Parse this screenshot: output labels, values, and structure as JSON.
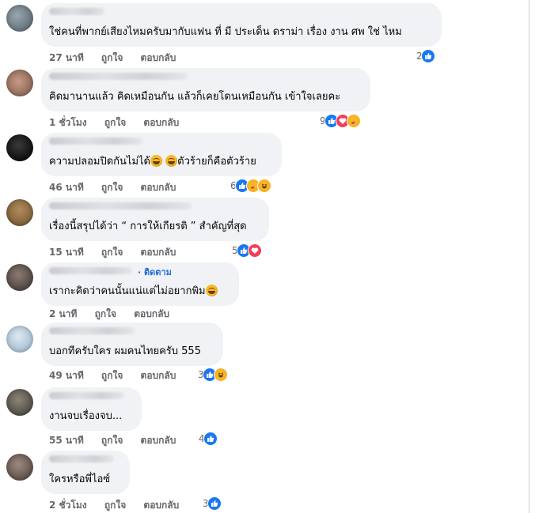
{
  "comments": [
    {
      "text": "ใช่คนที่พากย์เสียงไหมครับมากับแฟน ที่ มี ประเด็น ดราม่า เรื่อง งาน ศพ ใช่ ไหม",
      "time": "27 นาที",
      "like": "ถูกใจ",
      "reply": "ตอบกลับ",
      "count": "2",
      "reactions": [
        "like"
      ],
      "avatar": "#7c8a94"
    },
    {
      "text": "คิดมานานแล้ว คิดเหมือนกัน แล้วก็เคยโดนเหมือนกัน เข้าใจเลยคะ",
      "time": "1 ชั่วโมง",
      "like": "ถูกใจ",
      "reply": "ตอบกลับ",
      "count": "9",
      "reactions": [
        "like",
        "love",
        "care"
      ],
      "avatar": "#a07b6a"
    },
    {
      "text_before": "ความปลอมปิดกันไม่ได้",
      "text_after": "ตัวร้ายก็คือตัวร้าย",
      "emoji": "face-with-tears-of-joy",
      "time": "46 นาที",
      "like": "ถูกใจ",
      "reply": "ตอบกลับ",
      "count": "6",
      "reactions": [
        "like",
        "care",
        "haha"
      ],
      "avatar": "#1d1d1f"
    },
    {
      "text": "เรื่องนี้สรุปได้ว่า “ การให้เกียรติ ” สำคัญที่สุด",
      "time": "15 นาที",
      "like": "ถูกใจ",
      "reply": "ตอบกลับ",
      "count": "5",
      "reactions": [
        "like",
        "love"
      ],
      "avatar": "#8b6e45"
    },
    {
      "text": "เรากะคิดว่าคนนั้นแน่แต่ไม่อยากพิม",
      "emoji": "face-with-tears-of-joy",
      "follow": "· ติดตาม",
      "time": "2 นาที",
      "like": "ถูกใจ",
      "reply": "ตอบกลับ",
      "count": "",
      "reactions": [],
      "avatar": "#6e5e58"
    },
    {
      "text": "บอกทีครับใคร ผมคนไทยครับ 555",
      "time": "49 นาที",
      "like": "ถูกใจ",
      "reply": "ตอบกลับ",
      "count": "3",
      "reactions": [
        "like",
        "haha"
      ],
      "avatar": "#b8cbd9"
    },
    {
      "text": "งานจบเรื่องจบ...",
      "time": "55 นาที",
      "like": "ถูกใจ",
      "reply": "ตอบกลับ",
      "count": "4",
      "reactions": [
        "like"
      ],
      "avatar": "#5f5a52"
    },
    {
      "text": "ใครหรือพี่ไอซ์",
      "time": "2 ชั่วโมง",
      "like": "ถูกใจ",
      "reply": "ตอบกลับ",
      "count": "3",
      "reactions": [
        "like"
      ],
      "avatar": "#6d5d55"
    }
  ]
}
